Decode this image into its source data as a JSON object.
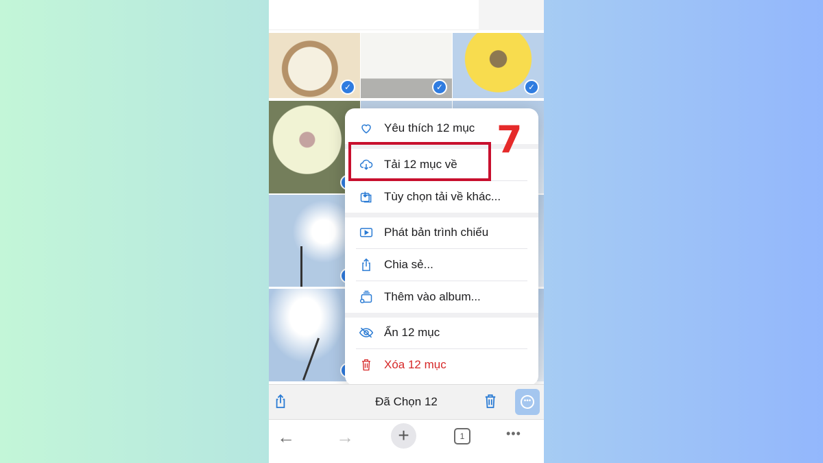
{
  "colors": {
    "accent": "#2a7bd4",
    "danger": "#d62828",
    "highlight_box": "#c8102e",
    "step_number": "#e52a2a"
  },
  "annotation": {
    "step": "7"
  },
  "photos": [
    {
      "subject": "noodle soup bowl",
      "selected": true
    },
    {
      "subject": "laptop screen",
      "selected": true
    },
    {
      "subject": "yellow sunflower",
      "selected": true
    },
    {
      "subject": "white gerbera flower",
      "selected": true
    },
    {
      "subject": "sky",
      "selected": true
    },
    {
      "subject": "sky",
      "selected": true
    },
    {
      "subject": "flower stem against sky",
      "selected": true
    },
    {
      "subject": "sky",
      "selected": true
    },
    {
      "subject": "sky",
      "selected": true
    },
    {
      "subject": "sunflower against clouds",
      "selected": true
    },
    {
      "subject": "sky",
      "selected": true
    },
    {
      "subject": "sky",
      "selected": true
    }
  ],
  "menu": {
    "items": [
      {
        "label": "Yêu thích 12 mục",
        "icon": "heart-icon"
      },
      {
        "label": "Tải 12 mục về",
        "icon": "cloud-download-icon"
      },
      {
        "label": "Tùy chọn tải về khác...",
        "icon": "download-tray-icon"
      },
      {
        "label": "Phát bản trình chiếu",
        "icon": "play-icon"
      },
      {
        "label": "Chia sẻ...",
        "icon": "share-icon"
      },
      {
        "label": "Thêm vào album...",
        "icon": "add-album-icon"
      },
      {
        "label": "Ẩn 12 mục",
        "icon": "eye-slash-icon"
      },
      {
        "label": "Xóa 12 mục",
        "icon": "trash-icon"
      }
    ]
  },
  "selection_bar": {
    "title": "Đã Chọn 12"
  },
  "browser": {
    "tab_count": "1"
  }
}
